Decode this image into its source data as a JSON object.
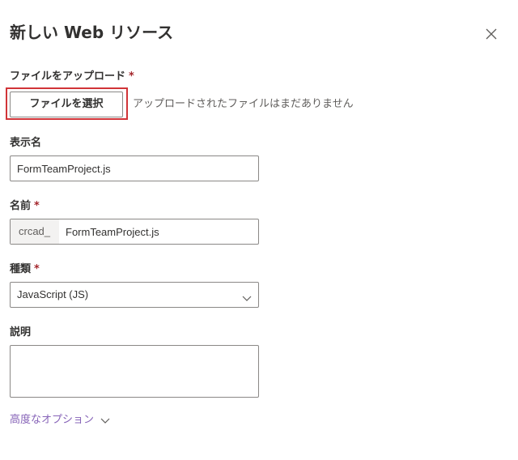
{
  "panel": {
    "title": "新しい Web リソース"
  },
  "upload": {
    "label": "ファイルをアップロード",
    "required_mark": "*",
    "button_label": "ファイルを選択",
    "status_text": "アップロードされたファイルはまだありません"
  },
  "display_name": {
    "label": "表示名",
    "value": "FormTeamProject.js"
  },
  "name": {
    "label": "名前",
    "required_mark": "*",
    "prefix": "crcad_",
    "value": "FormTeamProject.js"
  },
  "type": {
    "label": "種類",
    "required_mark": "*",
    "selected": "JavaScript (JS)"
  },
  "description": {
    "label": "説明",
    "value": ""
  },
  "advanced": {
    "label": "高度なオプション"
  },
  "colors": {
    "highlight": "#d13438",
    "required": "#a4262c",
    "link": "#8764b8",
    "border": "#8a8886"
  },
  "icons": {
    "close": "close-icon",
    "select_chevron": "chevron-down-icon",
    "advanced_chevron": "chevron-down-icon"
  }
}
